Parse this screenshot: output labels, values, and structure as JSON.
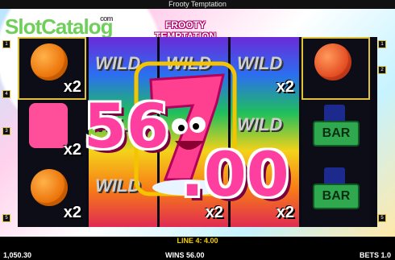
{
  "window": {
    "title": "Frooty Temptation"
  },
  "watermark": {
    "text": "SlotCatalog",
    "suffix": "com"
  },
  "logo": {
    "line1": "FROOTY",
    "line2": "TEMPTATION"
  },
  "reels": {
    "wild_label": "WILD",
    "bar_label": "BAR",
    "multipliers": {
      "r1c1": "x2",
      "r1c2": "x2",
      "r1c3": "x2",
      "r3c2": "x2",
      "r3c3": "x2",
      "r4c1": "x2",
      "r4c3": "x2",
      "r2c3": "x2"
    }
  },
  "side_numbers": [
    "1",
    "2",
    "3",
    "4",
    "5"
  ],
  "win_overlay": {
    "digits": "56",
    "decimals": ".00"
  },
  "status": {
    "line_win": "LINE 4: 4.00",
    "balance": "1,050.30",
    "wins": "WINS 56.00",
    "bets": "BETS 1.0"
  },
  "colors": {
    "accent_gold": "#e0c23a",
    "win_pink": "#ff3fa0",
    "line_yellow": "#f5d000"
  }
}
